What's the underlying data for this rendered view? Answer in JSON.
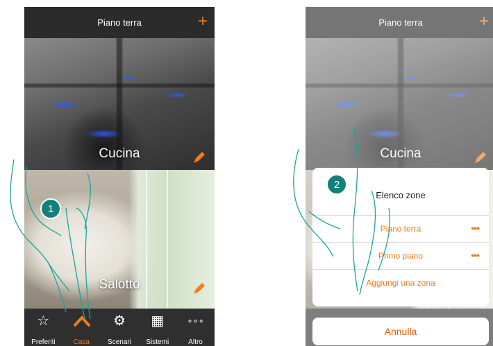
{
  "left_screen": {
    "title": "Piano terra",
    "add_icon": "+",
    "zones": [
      {
        "label": "Cucina",
        "icon": "pencil-icon"
      },
      {
        "label": "Salotto",
        "icon": "pencil-icon"
      }
    ],
    "tabs": [
      {
        "label": "Preferiti",
        "icon": "☆",
        "active": false
      },
      {
        "label": "Casa",
        "icon": "︿",
        "active": true
      },
      {
        "label": "Scenari",
        "icon": "⚙",
        "active": false
      },
      {
        "label": "Sistemi",
        "icon": "▦",
        "active": false
      },
      {
        "label": "Altro",
        "icon": "∘∘∘",
        "active": false
      }
    ],
    "step": "1"
  },
  "right_screen": {
    "title": "Piano terra",
    "add_icon": "+",
    "background_zone": "Cucina",
    "sheet": {
      "title": "Elenco zone",
      "rows": [
        {
          "label": "Piano terra",
          "more": "•••"
        },
        {
          "label": "Primo piano",
          "more": "•••"
        },
        {
          "label": "Aggiungi una zona",
          "more": ""
        }
      ],
      "cancel_label": "Annulla"
    },
    "step": "2"
  },
  "colors": {
    "accent": "#f07c1b",
    "top_bar": "#2b2b2b",
    "tab_bar": "#2f2f2f",
    "step_badge": "#14807b"
  }
}
